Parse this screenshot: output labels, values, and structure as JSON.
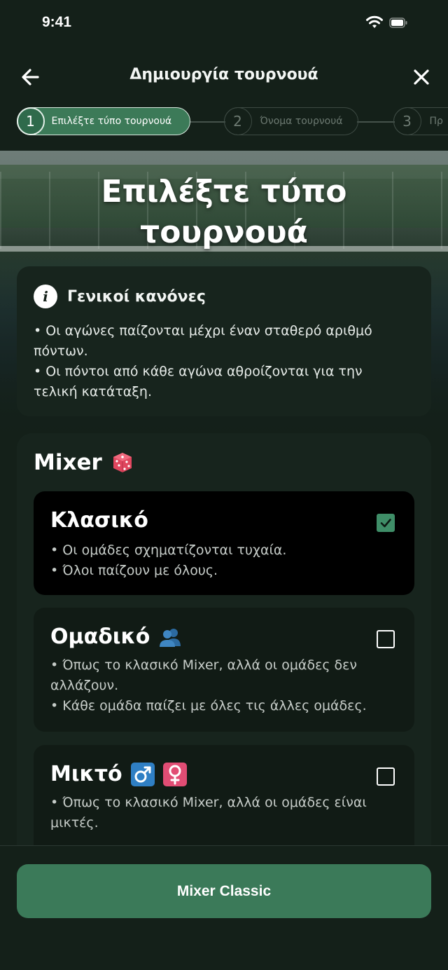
{
  "status_bar": {
    "time": "9:41"
  },
  "header": {
    "title": "Δημιουργία τουρνουά"
  },
  "steps": [
    {
      "number": "1",
      "label": "Επιλέξτε τύπο τουρνουά",
      "active": true
    },
    {
      "number": "2",
      "label": "Όνομα τουρνουά",
      "active": false
    },
    {
      "number": "3",
      "label": "Πρ",
      "active": false
    }
  ],
  "hero": {
    "title_line1": "Επιλέξτε τύπο",
    "title_line2": "τουρνουά"
  },
  "rules": {
    "title": "Γενικοί κανόνες",
    "line1": "• Οι αγώνες παίζονται μέχρι έναν σταθερό αριθμό",
    "line2": "πόντων.",
    "line3": "• Οι πόντοι από κάθε αγώνα αθροίζονται για την",
    "line4": "τελική κατάταξη."
  },
  "mixer": {
    "title": "Mixer",
    "options": [
      {
        "title": "Κλασικό",
        "selected": true,
        "lines": [
          "• Οι ομάδες σχηματίζονται τυχαία.",
          "• Όλοι παίζουν με όλους."
        ]
      },
      {
        "title": "Ομαδικό",
        "selected": false,
        "lines": [
          "• Όπως το κλασικό Mixer, αλλά οι ομάδες δεν",
          "αλλάζουν.",
          "• Κάθε ομάδα παίζει με όλες τις άλλες ομάδες."
        ]
      },
      {
        "title": "Μικτό",
        "selected": false,
        "lines": [
          "• Όπως το κλασικό Mixer, αλλά οι ομάδες είναι",
          "μικτές."
        ]
      }
    ]
  },
  "footer": {
    "button_label": "Mixer Classic"
  },
  "colors": {
    "accent": "#3b7a59",
    "background": "#142019",
    "card": "#17241d"
  }
}
